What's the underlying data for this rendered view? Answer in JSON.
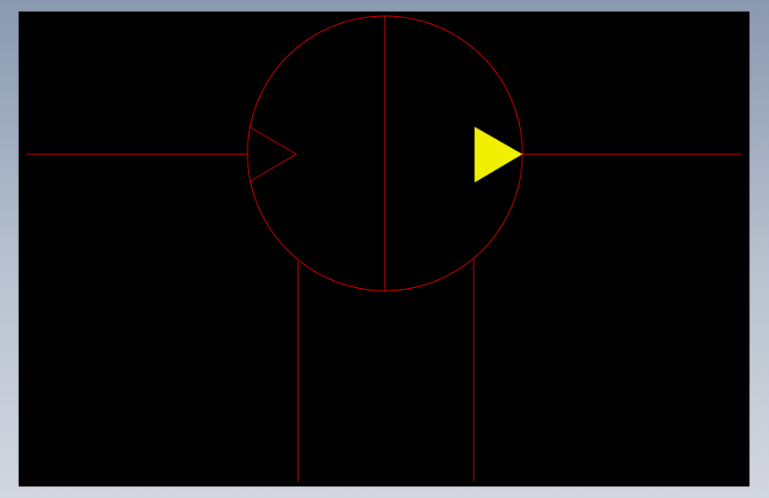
{
  "window": {
    "background": "gradient-blue-grey"
  },
  "viewport": {
    "background_color": "#000000"
  },
  "diagram": {
    "symbol": "hydraulic-pump-motor-symbol",
    "line_color": "#e00000",
    "fill_arrow_color": "#f0f000",
    "elements": [
      "outer-circle",
      "vertical-shaft-line",
      "inlet-line",
      "outlet-line",
      "inlet-open-triangle",
      "outlet-filled-triangle",
      "drain-line-left",
      "drain-line-right"
    ]
  }
}
